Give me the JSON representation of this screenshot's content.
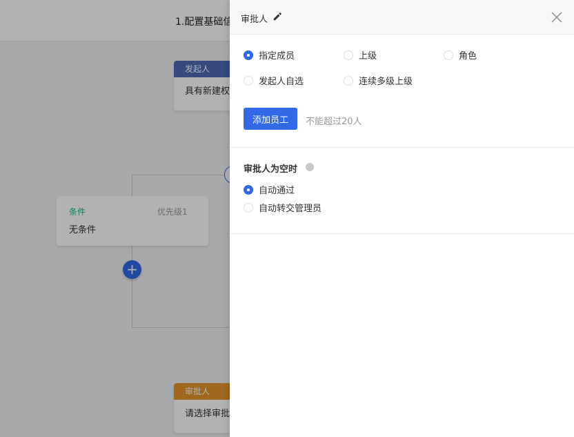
{
  "background": {
    "step_title": "1.配置基础信",
    "starter_node": {
      "header": "发起人",
      "body": "具有新建权"
    },
    "condition_node": {
      "label": "条件",
      "priority": "优先级1",
      "text": "无条件"
    },
    "approver_node": {
      "header": "审批人",
      "body": "请选择审批"
    },
    "add_button_label": "+"
  },
  "drawer": {
    "title": "审批人",
    "approver_type_options": [
      {
        "label": "指定成员",
        "checked": true
      },
      {
        "label": "上级",
        "checked": false
      },
      {
        "label": "角色",
        "checked": false
      },
      {
        "label": "发起人自选",
        "checked": false
      },
      {
        "label": "连续多级上级",
        "checked": false
      }
    ],
    "add_employee_label": "添加员工",
    "limit_hint": "不能超过20人",
    "empty_approver": {
      "title": "审批人为空时",
      "options": [
        {
          "label": "自动通过",
          "checked": true
        },
        {
          "label": "自动转交管理员",
          "checked": false
        }
      ]
    }
  },
  "colors": {
    "accent": "#3269e6",
    "starter_header": "#4e6bb3",
    "approver_header": "#e6962b",
    "condition_label": "#15bc83"
  }
}
